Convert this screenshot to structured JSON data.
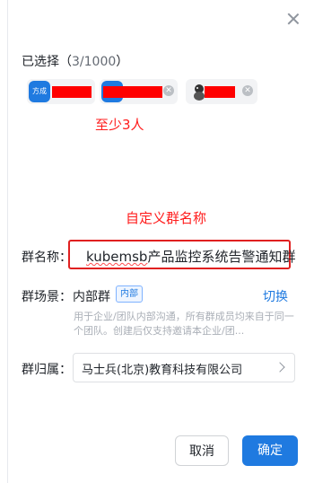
{
  "selected": {
    "label": "已选择（",
    "count": "3/1000",
    "close_paren": "）",
    "chips": [
      {
        "avatar_text": "方成",
        "name_redacted": true
      },
      {
        "avatar_text": "",
        "name_redacted": true
      },
      {
        "avatar_text": "",
        "name_redacted": true
      }
    ]
  },
  "annotations": {
    "min_people": "至少3人",
    "custom_name": "自定义群名称"
  },
  "form": {
    "group_name_label": "群名称：",
    "group_name_value_prefix": "kubemsb",
    "group_name_value_rest": "产品监控系统告警通知群",
    "group_scene_label": "群场景：",
    "group_scene_value": "内部群",
    "group_scene_badge": "内部",
    "switch_label": "切换",
    "scene_description": "用于企业/团队内部沟通，所有群成员均来自于同一个团队。创建后仅支持邀请本企业/团...",
    "owner_label": "群归属：",
    "owner_value": "马士兵(北京)教育科技有限公司"
  },
  "buttons": {
    "cancel": "取消",
    "confirm": "确定"
  },
  "colors": {
    "accent": "#1f7ae0",
    "annotation_red": "#ff1c1c"
  }
}
